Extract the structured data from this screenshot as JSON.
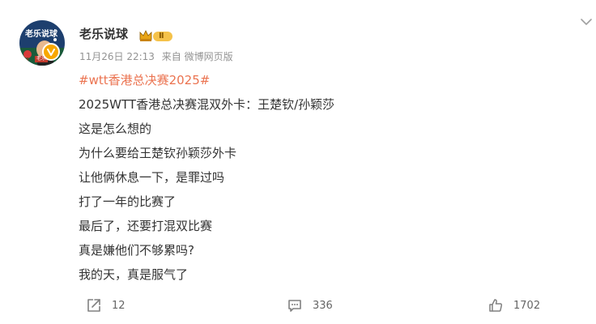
{
  "post": {
    "author": {
      "name": "老乐说球",
      "avatar_text": "老乐说球",
      "avatar_tag": "老乐",
      "verified_badge_icon": "verified-v-icon",
      "level_badge": "Ⅱ"
    },
    "meta": {
      "date": "11月26日 22:13",
      "source": "来自 微博网页版"
    },
    "hashtag": "#wtt香港总决赛2025#",
    "lines": [
      "2025WTT香港总决赛混双外卡：王楚钦/孙颖莎",
      "这是怎么想的",
      "为什么要给王楚钦孙颖莎外卡",
      "让他俩休息一下，是罪过吗",
      "打了一年的比赛了",
      "最后了，还要打混双比赛",
      "真是嫌他们不够累吗?",
      "我的天，真是服气了"
    ],
    "actions": {
      "share": {
        "icon": "share-icon",
        "count": "12"
      },
      "comment": {
        "icon": "comment-icon",
        "count": "336"
      },
      "like": {
        "icon": "thumbs-up-icon",
        "count": "1702"
      }
    },
    "more_icon": "chevron-down-icon"
  },
  "colors": {
    "text": "#333333",
    "meta": "#939393",
    "hashtag": "#eb7350",
    "verified": "#f8a800"
  }
}
